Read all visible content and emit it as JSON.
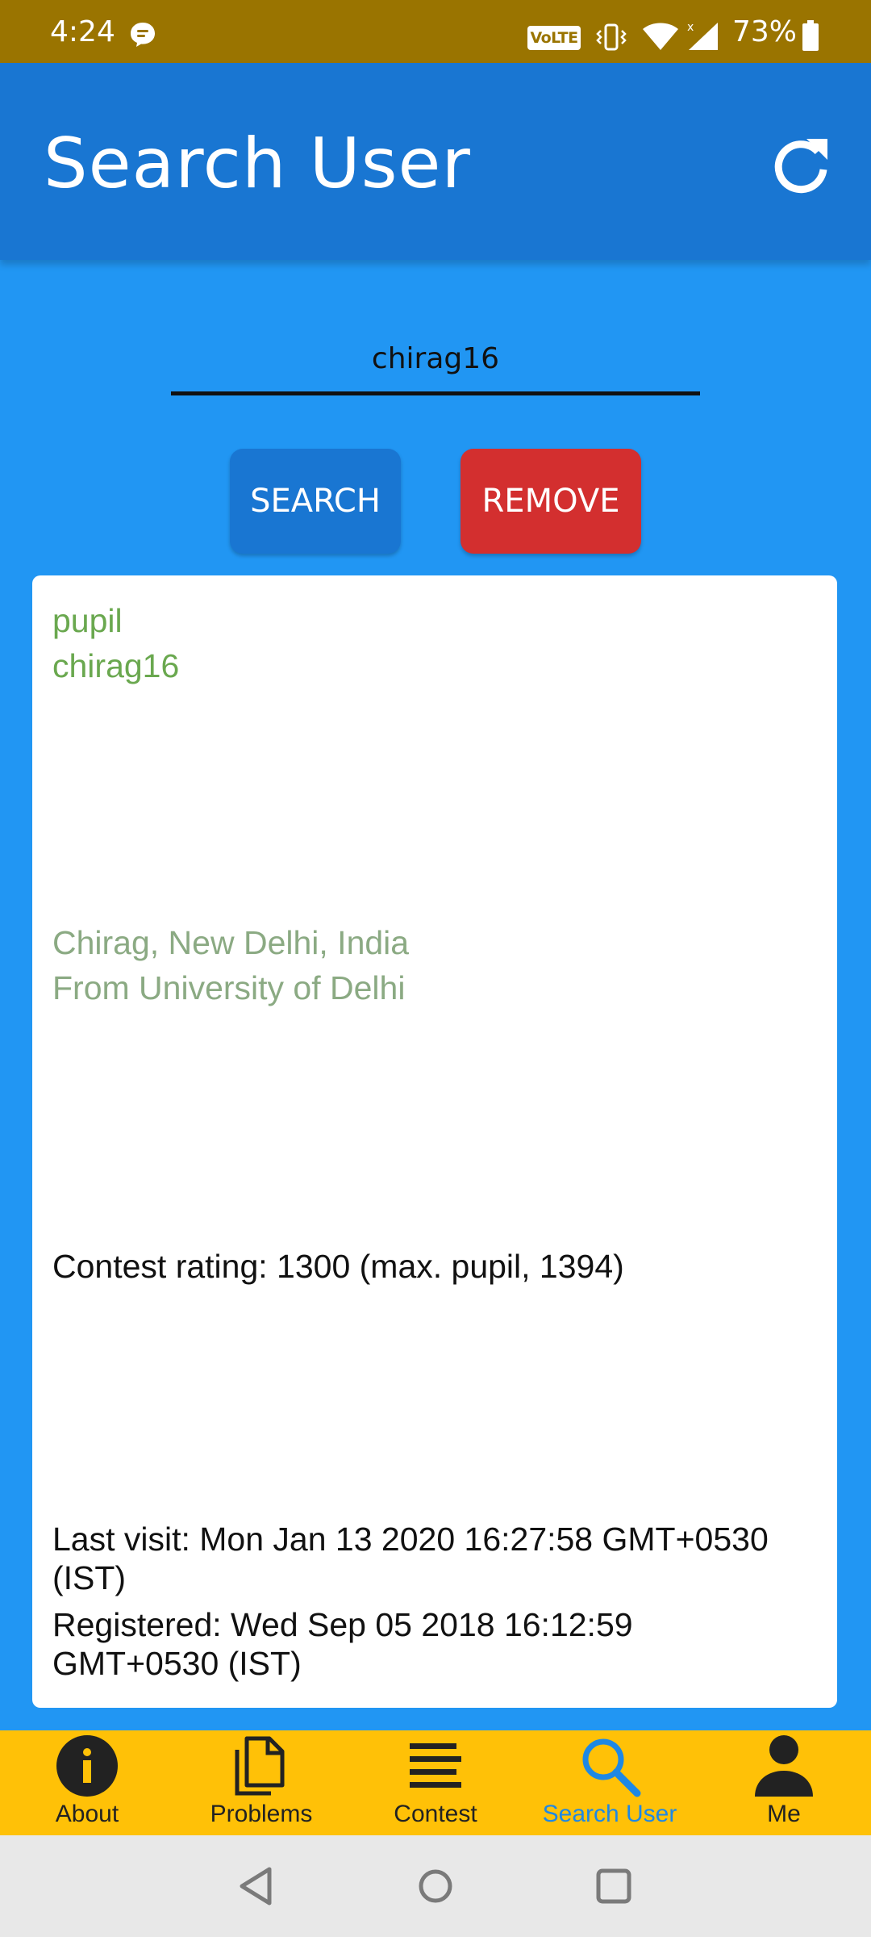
{
  "status_bar": {
    "time": "4:24",
    "volte": "VoLTE",
    "battery": "73%",
    "icons": [
      "message-icon",
      "vibrate-icon",
      "wifi-icon",
      "signal-icon",
      "battery-icon"
    ]
  },
  "app_bar": {
    "title": "Search User",
    "action_icon": "refresh-icon"
  },
  "search": {
    "value": "chirag16",
    "search_label": "SEARCH",
    "remove_label": "REMOVE"
  },
  "profile": {
    "rank": "pupil",
    "handle": "chirag16",
    "name_location": "Chirag, New Delhi, India",
    "organization": "From University of Delhi",
    "contest_rating": "Contest rating: 1300 (max. pupil, 1394)",
    "last_visit": "Last visit: Mon Jan 13 2020 16:27:58 GMT+0530 (IST)",
    "registered": "Registered: Wed Sep 05 2018 16:12:59 GMT+0530 (IST)"
  },
  "bottom_nav": {
    "items": [
      {
        "label": "About",
        "icon": "info-icon"
      },
      {
        "label": "Problems",
        "icon": "document-icon"
      },
      {
        "label": "Contest",
        "icon": "list-icon"
      },
      {
        "label": "Search User",
        "icon": "search-icon",
        "active": true
      },
      {
        "label": "Me",
        "icon": "person-icon"
      }
    ]
  },
  "colors": {
    "status_bar": "#9A7400",
    "app_bar": "#1976D2",
    "background": "#2196F3",
    "remove": "#D32F2F",
    "rank": "#6AA84F",
    "nav_bar": "#FFC107",
    "nav_active": "#1E88E5"
  }
}
